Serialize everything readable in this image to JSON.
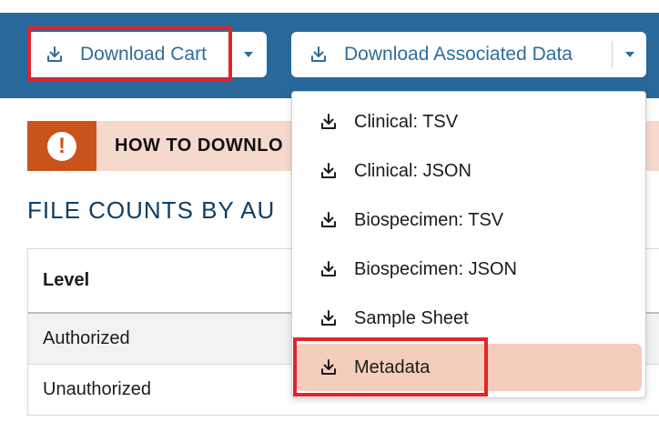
{
  "toolbar": {
    "download_cart_label": "Download Cart",
    "download_associated_label": "Download Associated Data"
  },
  "alert": {
    "text": "HOW TO DOWNLO"
  },
  "section": {
    "title": "FILE COUNTS BY AU"
  },
  "table": {
    "header": "Level",
    "rows": [
      "Authorized",
      "Unauthorized"
    ]
  },
  "dropdown": {
    "items": [
      {
        "label": "Clinical: TSV"
      },
      {
        "label": "Clinical: JSON"
      },
      {
        "label": "Biospecimen: TSV"
      },
      {
        "label": "Biospecimen: JSON"
      },
      {
        "label": "Sample Sheet"
      },
      {
        "label": "Metadata"
      }
    ],
    "active_item": "Metadata"
  },
  "colors": {
    "toolbar_bg": "#28689a",
    "button_text": "#2e6d9d",
    "highlight_red": "#e0242c",
    "alert_orange": "#c8541c",
    "alert_bg": "#f6d9cd",
    "active_item_bg": "#f4cdbd"
  },
  "icons": {
    "download": "download-icon",
    "caret": "chevron-down-icon",
    "alert": "exclamation-icon"
  }
}
